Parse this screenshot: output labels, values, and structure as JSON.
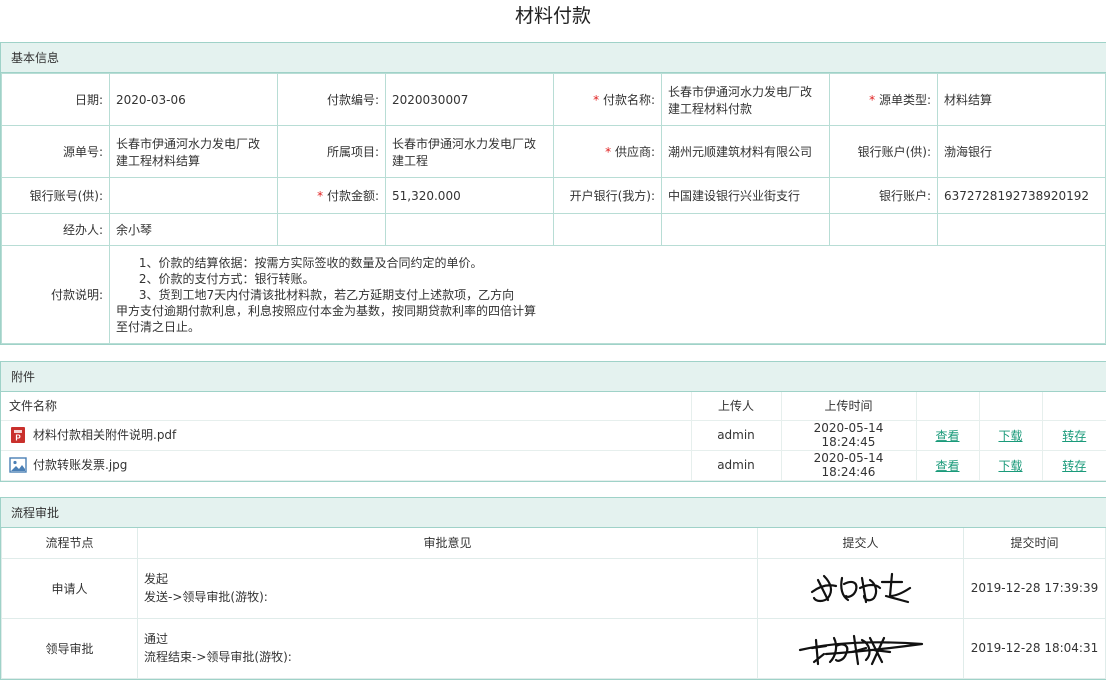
{
  "title": "材料付款",
  "basic": {
    "header": "基本信息",
    "date_label": "日期:",
    "date": "2020-03-06",
    "pay_no_label": "付款编号:",
    "pay_no": "2020030007",
    "pay_name_label": "付款名称:",
    "pay_name": "长春市伊通河水力发电厂改建工程材料付款",
    "src_type_label": "源单类型:",
    "src_type": "材料结算",
    "src_no_label": "源单号:",
    "src_no": "长春市伊通河水力发电厂改建工程材料结算",
    "project_label": "所属项目:",
    "project": "长春市伊通河水力发电厂改建工程",
    "supplier_label": "供应商:",
    "supplier": "潮州元顺建筑材料有限公司",
    "bank_sup_label": "银行账户(供):",
    "bank_sup": "渤海银行",
    "bankno_sup_label": "银行账号(供):",
    "bankno_sup": "",
    "amount_label": "付款金额:",
    "amount": "51,320.000",
    "our_bank_label": "开户银行(我方):",
    "our_bank": "中国建设银行兴业街支行",
    "bank_acct_label": "银行账户:",
    "bank_acct": "6372728192738920192",
    "handler_label": "经办人:",
    "handler": "余小琴",
    "desc_label": "付款说明:",
    "desc": "      1、价款的结算依据：按需方实际签收的数量及合同约定的单价。\n      2、价款的支付方式：银行转账。\n      3、货到工地7天内付清该批材料款，若乙方延期支付上述款项，乙方向\n甲方支付逾期付款利息，利息按照应付本金为基数，按同期贷款利率的四倍计算\n至付清之日止。"
  },
  "attach": {
    "header": "附件",
    "cols": [
      "文件名称",
      "上传人",
      "上传时间"
    ],
    "rows": [
      {
        "name": "材料付款相关附件说明.pdf",
        "icon": "pdf-file-icon",
        "uploader": "admin",
        "time": "2020-05-14 18:24:45",
        "view": "查看",
        "download": "下载",
        "save": "转存"
      },
      {
        "name": "付款转账发票.jpg",
        "icon": "image-file-icon",
        "uploader": "admin",
        "time": "2020-05-14 18:24:46",
        "view": "查看",
        "download": "下载",
        "save": "转存"
      }
    ]
  },
  "flow": {
    "header": "流程审批",
    "cols": [
      "流程节点",
      "审批意见",
      "提交人",
      "提交时间"
    ],
    "rows": [
      {
        "node": "申请人",
        "opinion": "发起",
        "action": "发送->领导审批(游牧):",
        "time": "2019-12-28 17:39:39"
      },
      {
        "node": "领导审批",
        "opinion": "通过",
        "action": "流程结束->领导审批(游牧):",
        "time": "2019-12-28 18:04:31"
      }
    ]
  },
  "colors": {
    "border": "#9fd2c8",
    "header_bg": "#e4f2ef",
    "link": "#1a9a7a",
    "required": "#e02020"
  }
}
